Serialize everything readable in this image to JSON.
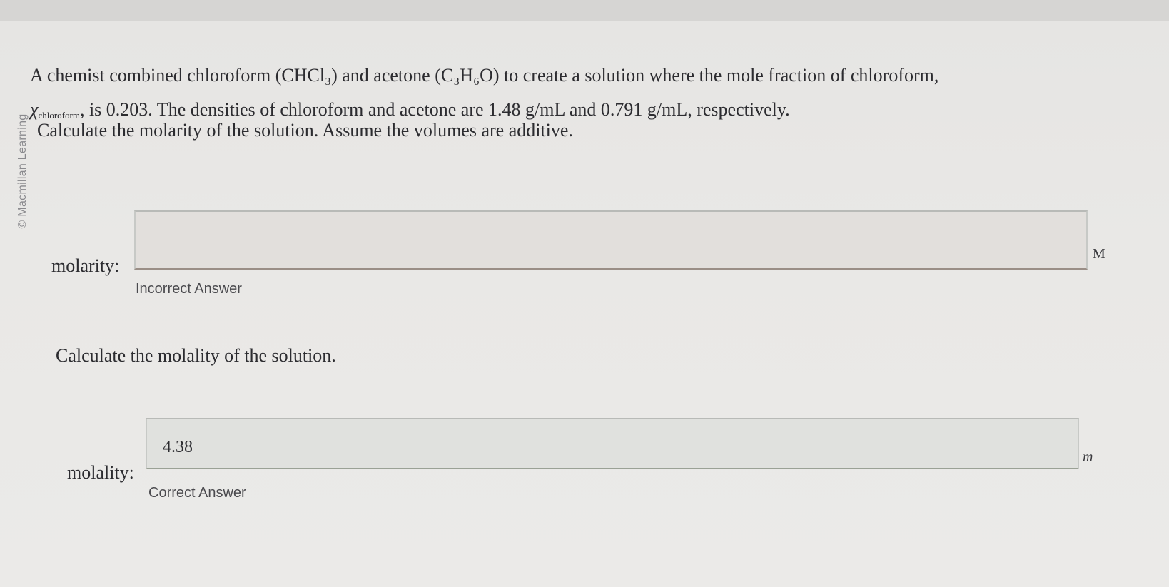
{
  "watermark": "© Macmillan Learning",
  "question": {
    "line1": "A chemist combined chloroform (CHCl₃) and acetone (C₃H₆O) to create a solution where the mole fraction of chloroform,",
    "chi_symbol": "χ",
    "chi_subscript": "chloroform",
    "line2_rest": ", is 0.203. The densities of chloroform and acetone are 1.48 g/mL and 0.791 g/mL, respectively."
  },
  "part1": {
    "prompt": "Calculate the molarity of the solution. Assume the volumes are additive.",
    "label": "molarity:",
    "value": "",
    "unit": "M",
    "feedback": "Incorrect Answer"
  },
  "part2": {
    "prompt": "Calculate the molality of the solution.",
    "label": "molality:",
    "value": "4.38",
    "unit": "m",
    "feedback": "Correct Answer"
  }
}
